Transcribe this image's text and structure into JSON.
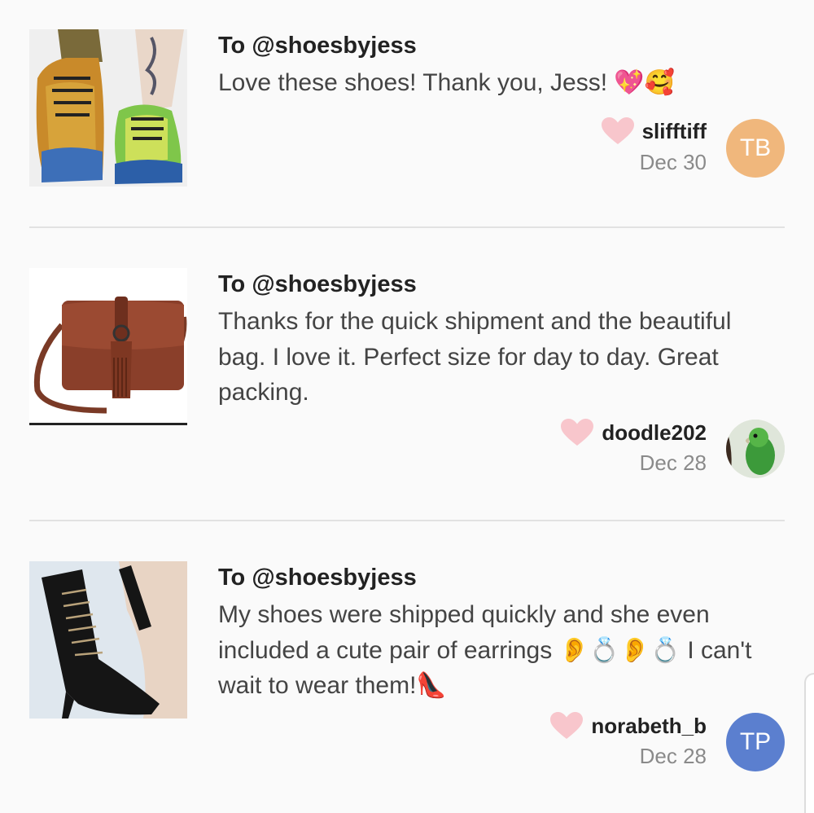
{
  "reviews": [
    {
      "image_alt": "holographic sneakers",
      "to": "To @shoesbyjess",
      "text": "Love these shoes! Thank you, Jess! 💖🥰",
      "username": "slifftiff",
      "date": "Dec 30",
      "avatar_initials": "TB",
      "avatar_color": "#f0b77c",
      "liked": false
    },
    {
      "image_alt": "brown leather crossbody bag with tassel",
      "to": "To @shoesbyjess",
      "text": "Thanks for the quick shipment and the beautiful bag. I love it. Perfect size for day to day. Great packing.",
      "username": "doodle202",
      "date": "Dec 28",
      "avatar_initials": "",
      "avatar_color": "#b7c9a8",
      "liked": false
    },
    {
      "image_alt": "black lace-up heeled boot",
      "to": "To @shoesbyjess",
      "text": "My shoes were shipped quickly and she even included a cute pair of earrings 👂💍👂💍 I can't wait to wear them!👠",
      "username": "norabeth_b",
      "date": "Dec 28",
      "avatar_initials": "TP",
      "avatar_color": "#5b7fcf",
      "liked": false
    }
  ],
  "colors": {
    "heart": "#f8c6cc",
    "background": "#fafafa",
    "divider": "#e2e2e2"
  }
}
